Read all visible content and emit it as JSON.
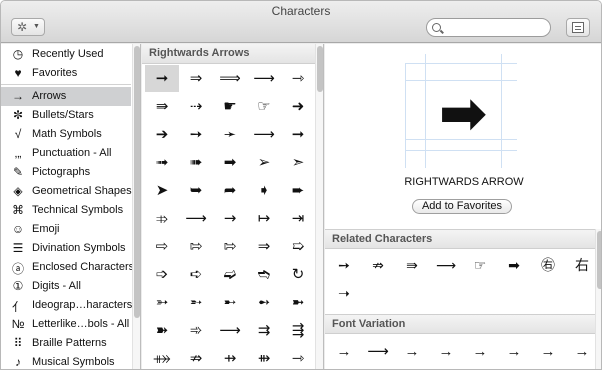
{
  "window": {
    "title": "Characters"
  },
  "toolbar": {
    "gear_icon": "gear-icon",
    "search_value": "",
    "search_placeholder": ""
  },
  "sidebar": {
    "items": [
      {
        "icon": "◷",
        "label": "Recently Used"
      },
      {
        "icon": "♥",
        "label": "Favorites"
      },
      {
        "icon": "→",
        "label": "Arrows",
        "selected": true
      },
      {
        "icon": "✼",
        "label": "Bullets/Stars"
      },
      {
        "icon": "√",
        "label": "Math Symbols"
      },
      {
        "icon": "‚„",
        "label": "Punctuation - All"
      },
      {
        "icon": "✎",
        "label": "Pictographs"
      },
      {
        "icon": "◈",
        "label": "Geometrical Shapes"
      },
      {
        "icon": "⌘",
        "label": "Technical Symbols"
      },
      {
        "icon": "☺",
        "label": "Emoji"
      },
      {
        "icon": "☰",
        "label": "Divination Symbols"
      },
      {
        "icon": "ⓐ",
        "label": "Enclosed Characters"
      },
      {
        "icon": "①",
        "label": "Digits - All"
      },
      {
        "icon": "亻",
        "label": "Ideograp…haracters"
      },
      {
        "icon": "№",
        "label": "Letterlike…bols - All"
      },
      {
        "icon": "⠿",
        "label": "Braille Patterns"
      },
      {
        "icon": "♪",
        "label": "Musical Symbols"
      }
    ]
  },
  "grid": {
    "header": "Rightwards Arrows",
    "rows": [
      [
        "➞",
        "⇒",
        "⟹",
        "⟶",
        "⇾"
      ],
      [
        "⇛",
        "⇢",
        "☛",
        "☞",
        "➜"
      ],
      [
        "➔",
        "➙",
        "➛",
        "⟶",
        "➞"
      ],
      [
        "➟",
        "➠",
        "➡",
        "➢",
        "➣"
      ],
      [
        "➤",
        "➥",
        "➦",
        "➧",
        "➨"
      ],
      [
        "⤃",
        "⟶",
        "→",
        "↦",
        "⇥"
      ],
      [
        "⇨",
        "⇰",
        "⇰",
        "⇒",
        "➯"
      ],
      [
        "➩",
        "➪",
        "➫",
        "➬",
        "↻"
      ],
      [
        "➳",
        "➵",
        "➸",
        "➻",
        "➼"
      ],
      [
        "➽",
        "➾",
        "⟶",
        "⇉",
        "⇶"
      ],
      [
        "⤁",
        "⇏",
        "⇸",
        "⇻",
        "⇾"
      ]
    ]
  },
  "detail": {
    "glyph": "➡",
    "char_name": "RIGHTWARDS ARROW",
    "add_favorites_label": "Add to Favorites",
    "related_header": "Related Characters",
    "related": [
      "➙",
      "⇏",
      "⇛",
      "⟶",
      "☞",
      "➡",
      "㊨",
      "右",
      "➝"
    ],
    "font_variation_header": "Font Variation",
    "font_variations": [
      "→",
      "⟶",
      "→",
      "→",
      "→",
      "→",
      "→",
      "→"
    ]
  }
}
